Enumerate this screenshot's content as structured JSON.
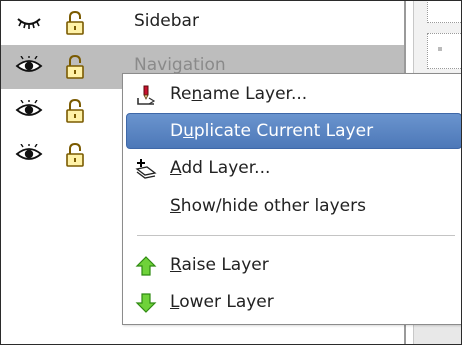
{
  "layers": [
    {
      "name": "Sidebar",
      "visible_icon": "eye-closed-icon",
      "lock_icon": "unlock-icon",
      "selected": false
    },
    {
      "name": "Navigation",
      "visible_icon": "eye-open-icon",
      "lock_icon": "unlock-icon",
      "selected": true
    },
    {
      "name": "",
      "visible_icon": "eye-open-icon",
      "lock_icon": "unlock-icon",
      "selected": false
    },
    {
      "name": "",
      "visible_icon": "eye-open-icon",
      "lock_icon": "unlock-icon",
      "selected": false
    }
  ],
  "context_menu": {
    "items": [
      {
        "label_pre": "Re",
        "label_mn": "n",
        "label_post": "ame Layer...",
        "icon": "rename-layer-icon"
      },
      {
        "label_pre": "D",
        "label_mn": "u",
        "label_post": "plicate Current Layer",
        "icon": "",
        "highlighted": true
      },
      {
        "label_pre": "",
        "label_mn": "A",
        "label_post": "dd Layer...",
        "icon": "add-layer-icon"
      },
      {
        "label_pre": "",
        "label_mn": "S",
        "label_post": "how/hide other layers",
        "icon": ""
      },
      {
        "label_pre": "",
        "label_mn": "R",
        "label_post": "aise Layer",
        "icon": "raise-arrow-icon"
      },
      {
        "label_pre": "",
        "label_mn": "L",
        "label_post": "ower Layer",
        "icon": "lower-arrow-icon"
      }
    ]
  },
  "colors": {
    "selection_row": "#bdbdbd",
    "menu_highlight": "#5a85c4",
    "raise_green": "#5cc72e",
    "lower_green": "#5cc72e"
  }
}
